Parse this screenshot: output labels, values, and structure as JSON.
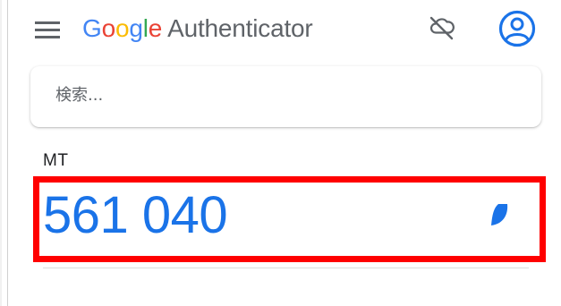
{
  "app_bar": {
    "google_letters": [
      "G",
      "o",
      "o",
      "g",
      "l",
      "e"
    ],
    "title_suffix": "Authenticator",
    "icons": {
      "menu": "hamburger-menu-icon",
      "cloud": "cloud-off-icon",
      "account": "account-circle-icon"
    }
  },
  "search": {
    "placeholder": "検索..."
  },
  "accounts": [
    {
      "label": "MT",
      "code": "561 040",
      "timer_icon": "countdown-timer-icon"
    }
  ],
  "colors": {
    "code": "#1a73e8",
    "highlight": "#ff0000",
    "google_blue": "#4285f4",
    "google_red": "#ea4335",
    "google_yellow": "#fbbc05",
    "google_green": "#34a853"
  }
}
